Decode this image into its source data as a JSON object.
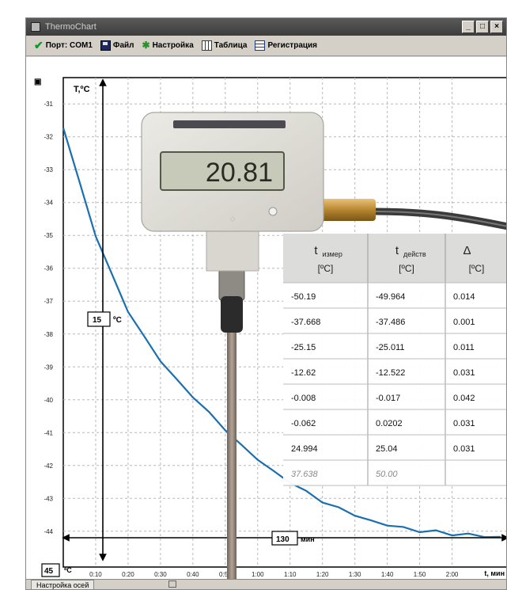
{
  "window": {
    "title": "ThermoChart",
    "controls": {
      "minimize": "_",
      "maximize": "□",
      "close": "×"
    }
  },
  "toolbar": {
    "port_label": "Порт: COM1",
    "file_label": "Файл",
    "settings_label": "Настройка",
    "table_label": "Таблица",
    "register_label": "Регистрация"
  },
  "device": {
    "reading": "20.81"
  },
  "overlay": {
    "temp_value": "15",
    "temp_unit": "ºC",
    "time_value": "130",
    "time_unit": "мин",
    "y_min_value": "45",
    "y_min_unit": "ºC"
  },
  "calib_table": {
    "headers": [
      {
        "main": "t",
        "sub": "измер",
        "unit": "[ºC]"
      },
      {
        "main": "t",
        "sub": "действ",
        "unit": "[ºC]"
      },
      {
        "main": "Δ",
        "sub": "",
        "unit": "[ºC]"
      }
    ],
    "rows": [
      [
        "-50.19",
        "-49.964",
        "0.014"
      ],
      [
        "-37.668",
        "-37.486",
        "0.001"
      ],
      [
        "-25.15",
        "-25.011",
        "0.011"
      ],
      [
        "-12.62",
        "-12.522",
        "0.031"
      ],
      [
        "-0.008",
        "-0.017",
        "0.042"
      ],
      [
        "-0.062",
        "0.0202",
        "0.031"
      ],
      [
        "24.994",
        "25.04",
        "0.031"
      ],
      [
        "37.638",
        "50.00",
        ""
      ]
    ]
  },
  "status": {
    "tab_label": "Настройка осей"
  },
  "chart_data": {
    "type": "line",
    "xlabel": "t, мин",
    "ylabel": "T,ºC",
    "x_ticks": [
      "0:10",
      "0:20",
      "0:30",
      "0:40",
      "0:50",
      "1:00",
      "1:10",
      "1:20",
      "1:30",
      "1:40",
      "1:50",
      "2:00"
    ],
    "y_ticks": [
      "-31",
      "-32",
      "-33",
      "-34",
      "-35",
      "-36",
      "-37",
      "-38",
      "-39",
      "-40",
      "-41",
      "-42",
      "-43",
      "-44"
    ],
    "y_tick_values": [
      -31,
      -32,
      -33,
      -34,
      -35,
      -36,
      -37,
      -38,
      -39,
      -40,
      -41,
      -42,
      -43,
      -44
    ],
    "xlim": [
      0,
      135
    ],
    "ylim": [
      -44.8,
      -30.2
    ],
    "grid": true,
    "series": [
      {
        "color": "#1a6fb0",
        "x": [
          0,
          5,
          10,
          15,
          20,
          25,
          30,
          35,
          40,
          45,
          50,
          55,
          60,
          65,
          70,
          75,
          80,
          85,
          90,
          95,
          100,
          105,
          110,
          115,
          120,
          125,
          130,
          135
        ],
        "y": [
          -31.7,
          -33.4,
          -35.0,
          -36.2,
          -37.3,
          -38.1,
          -38.8,
          -39.4,
          -39.9,
          -40.4,
          -40.9,
          -41.4,
          -41.8,
          -42.2,
          -42.5,
          -42.8,
          -43.1,
          -43.3,
          -43.5,
          -43.7,
          -43.8,
          -43.9,
          -44.0,
          -44.0,
          -44.1,
          -44.1,
          -44.15,
          -44.2
        ]
      }
    ]
  },
  "colors": {
    "series": "#1a6fb0",
    "grid": "#b8b8b8",
    "lcd": "#c7cab8",
    "device": "#e4e2dc"
  }
}
